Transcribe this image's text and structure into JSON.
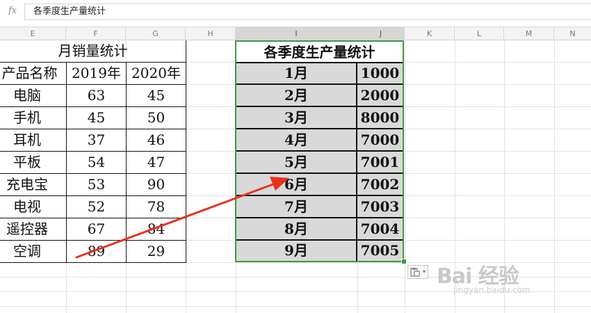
{
  "formula_bar": {
    "fx_label": "fx",
    "value": "各季度生产量统计"
  },
  "columns": [
    "E",
    "F",
    "G",
    "H",
    "I",
    "J",
    "K",
    "L",
    "M",
    "N"
  ],
  "monthly_sales": {
    "title": "月销量统计",
    "headers": [
      "产品名称",
      "2019年",
      "2020年"
    ],
    "rows": [
      [
        "电脑",
        "63",
        "45"
      ],
      [
        "手机",
        "45",
        "50"
      ],
      [
        "耳机",
        "37",
        "46"
      ],
      [
        "平板",
        "54",
        "47"
      ],
      [
        "充电宝",
        "53",
        "90"
      ],
      [
        "电视",
        "52",
        "78"
      ],
      [
        "遥控器",
        "67",
        "84"
      ],
      [
        "空调",
        "89",
        "29"
      ]
    ]
  },
  "quarterly_production": {
    "title": "各季度生产量统计",
    "rows": [
      [
        "1月",
        "1000"
      ],
      [
        "2月",
        "2000"
      ],
      [
        "3月",
        "8000"
      ],
      [
        "4月",
        "7000"
      ],
      [
        "5月",
        "7001"
      ],
      [
        "6月",
        "7002"
      ],
      [
        "7月",
        "7003"
      ],
      [
        "8月",
        "7004"
      ],
      [
        "9月",
        "7005"
      ]
    ]
  },
  "paste_options_icon": "paste-options-icon",
  "watermark": {
    "logo_text": "Bai 经验",
    "url_text": "jingyan.baidu.com"
  },
  "colors": {
    "selection_border": "#3c9a3c",
    "arrow": "#e8321e",
    "cell_fill": "#d9d9d9"
  }
}
